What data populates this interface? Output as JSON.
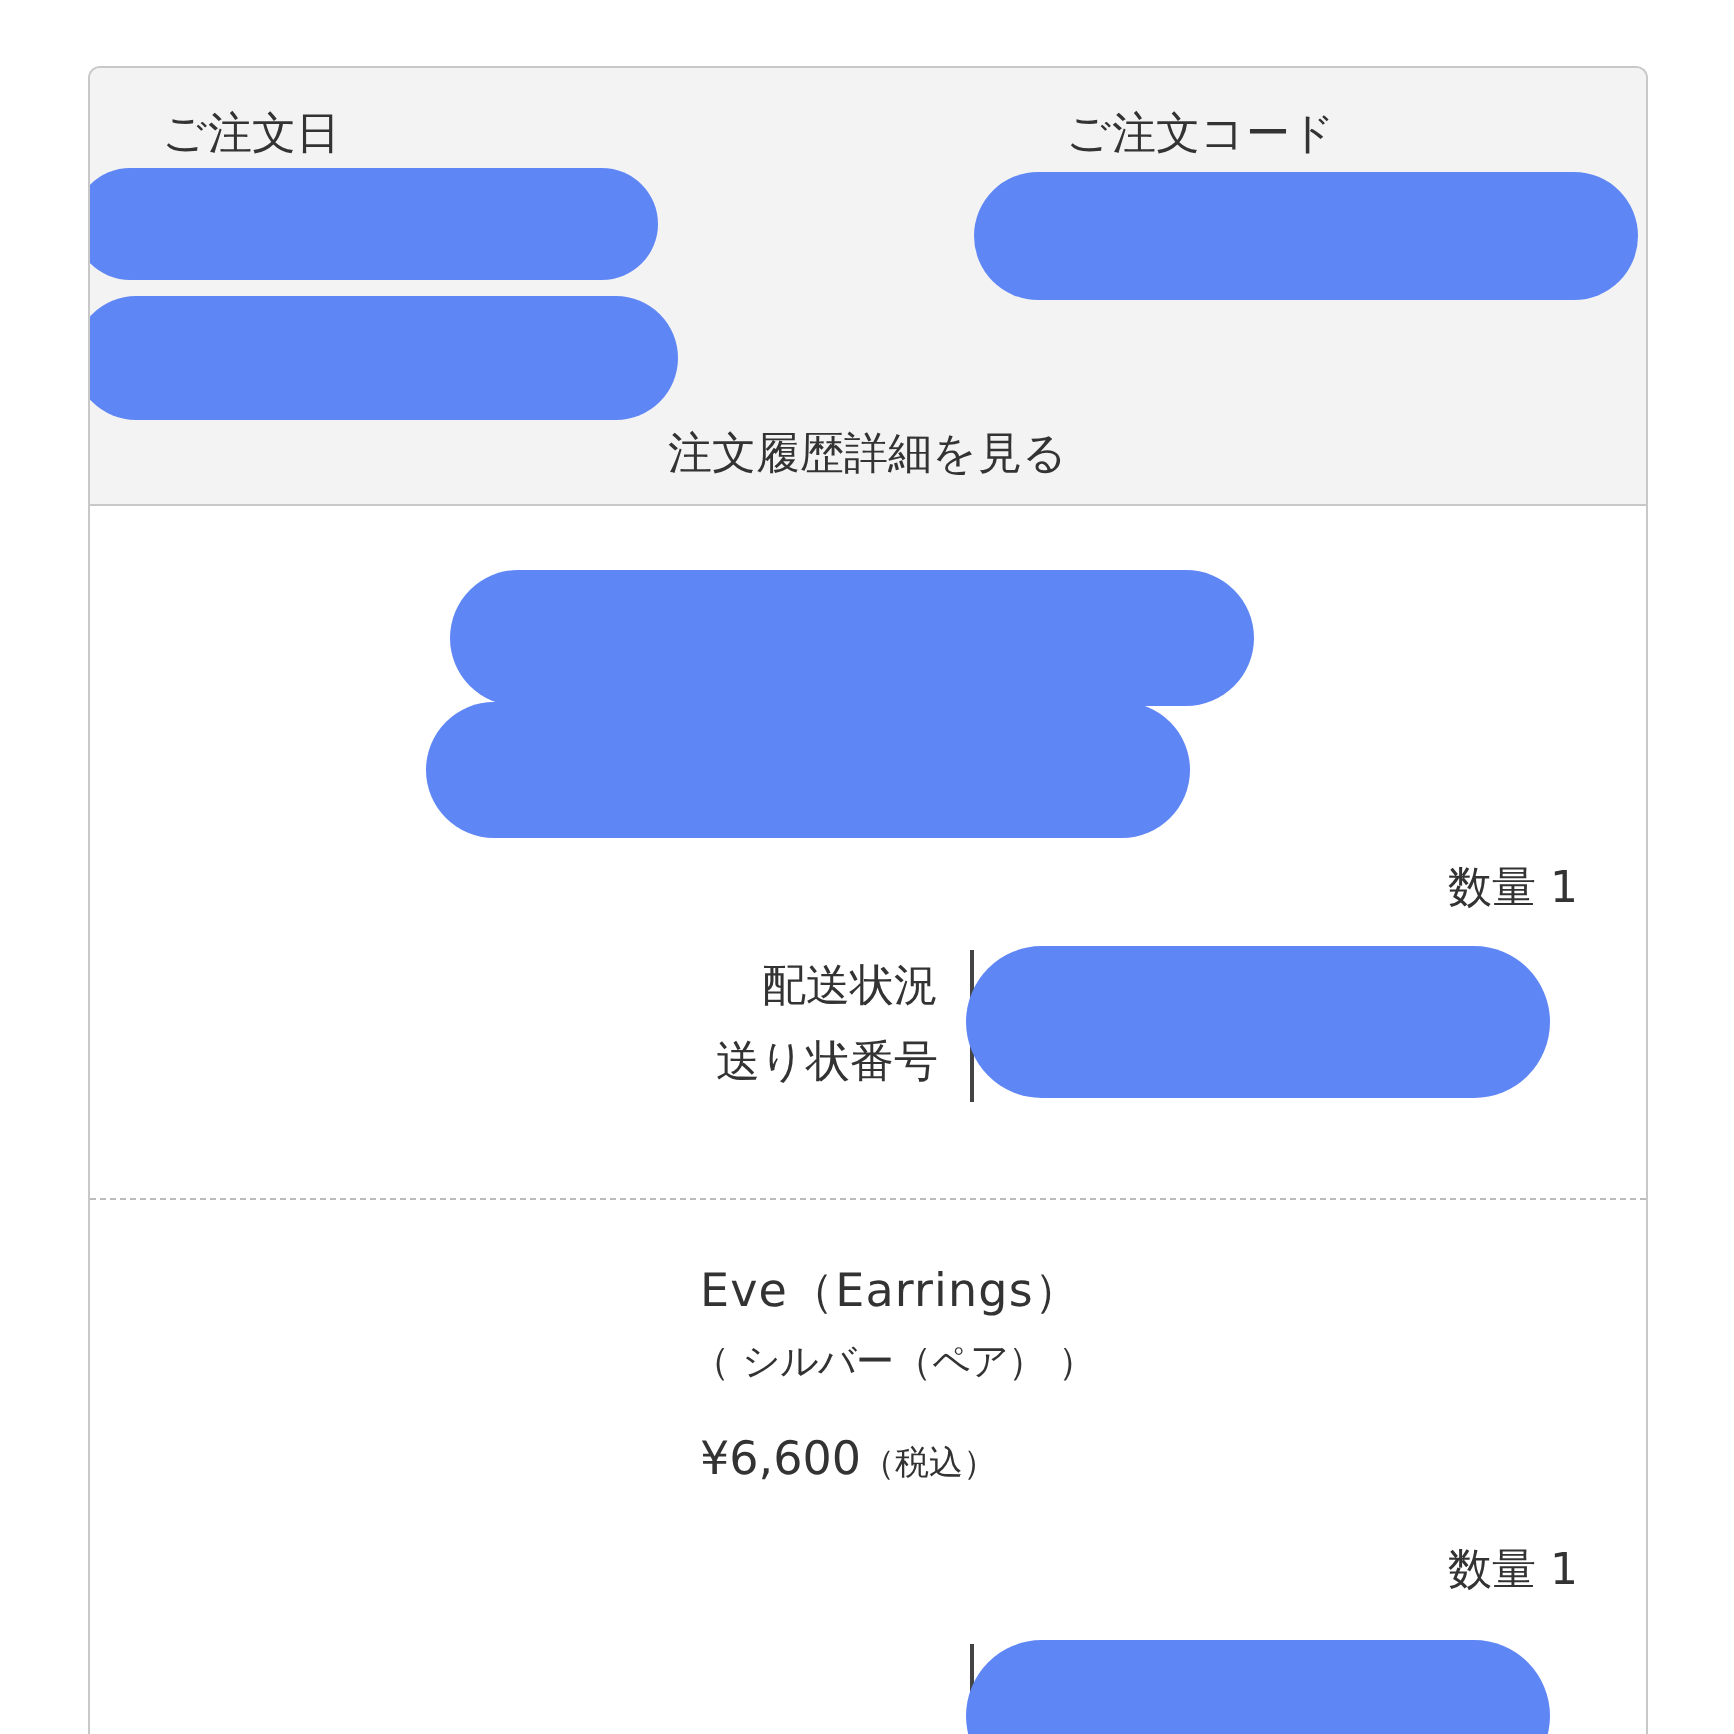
{
  "header": {
    "fields": [
      {
        "label": "ご注文日",
        "redacted": true
      },
      {
        "label": "ご注文コード",
        "redacted": true
      }
    ],
    "link": "注文履歴詳細を見る"
  },
  "items": [
    {
      "name_redacted": true,
      "quantity": "数量 1",
      "shipping": {
        "labels": [
          "配送状況",
          "送り状番号"
        ],
        "redacted": true
      }
    },
    {
      "name_redacted": false,
      "name": "Eve（Earrings）",
      "variant": "（ シルバー（ペア） ）",
      "price": "¥6,600",
      "tax": "（税込）",
      "quantity": "数量 1",
      "shipping": {
        "redacted": true
      }
    }
  ]
}
